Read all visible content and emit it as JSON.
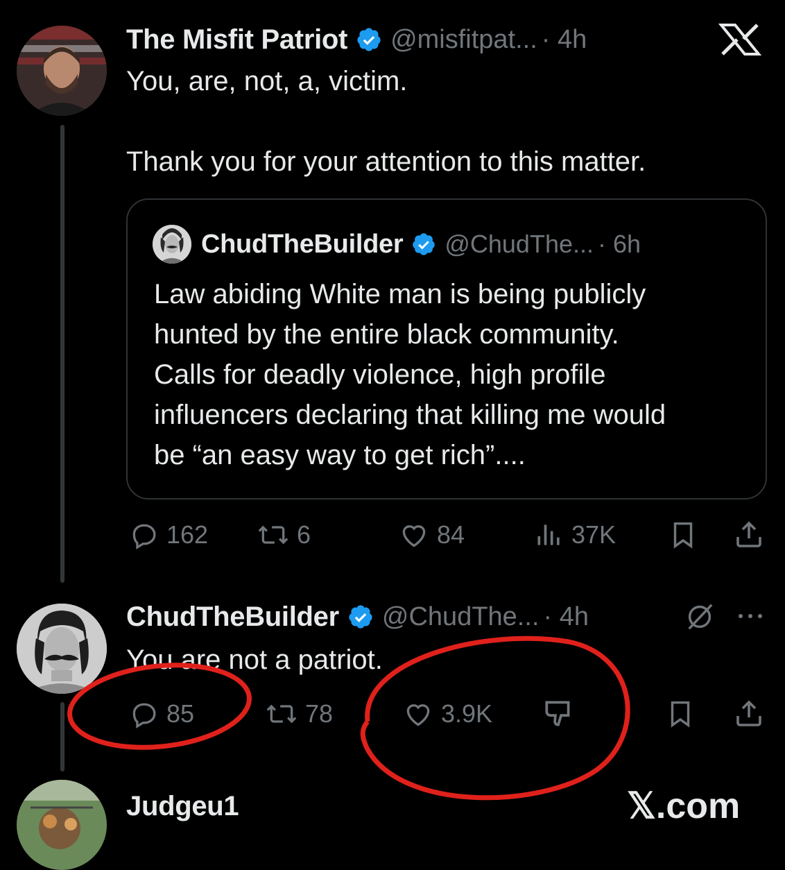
{
  "main_tweet": {
    "author_name": "The Misfit Patriot",
    "handle": "@misfitpat...",
    "time": "· 4h",
    "text_line1": "You, are, not, a, victim.",
    "text_line2": "Thank you for your attention to this matter.",
    "quote": {
      "author_name": "ChudTheBuilder",
      "handle": "@ChudThe...",
      "time": "· 6h",
      "lines": [
        "Law abiding White man is being publicly",
        "hunted by the entire black community.",
        "Calls for deadly violence, high profile",
        "influencers declaring that killing me would",
        "be “an easy way to get rich”...."
      ]
    },
    "stats": {
      "replies": "162",
      "reposts": "6",
      "likes": "84",
      "views": "37K"
    }
  },
  "reply_tweet": {
    "author_name": "ChudTheBuilder",
    "handle": "@ChudThe...",
    "time": "· 4h",
    "text": "You are not a patriot.",
    "stats": {
      "replies": "85",
      "reposts": "78",
      "likes": "3.9K"
    }
  },
  "next_reply": {
    "author_name": "Judgeu1"
  },
  "watermark": "𝕏.com",
  "colors": {
    "background": "#000000",
    "text": "#e7e9ea",
    "muted": "#71767b",
    "verified": "#1d9bf0",
    "annotation": "#e0211b"
  },
  "icons": [
    "x-logo-icon",
    "verified-badge-icon",
    "reply-icon",
    "repost-icon",
    "like-icon",
    "views-icon",
    "bookmark-icon",
    "share-icon",
    "dislike-icon",
    "grok-icon",
    "more-icon"
  ]
}
